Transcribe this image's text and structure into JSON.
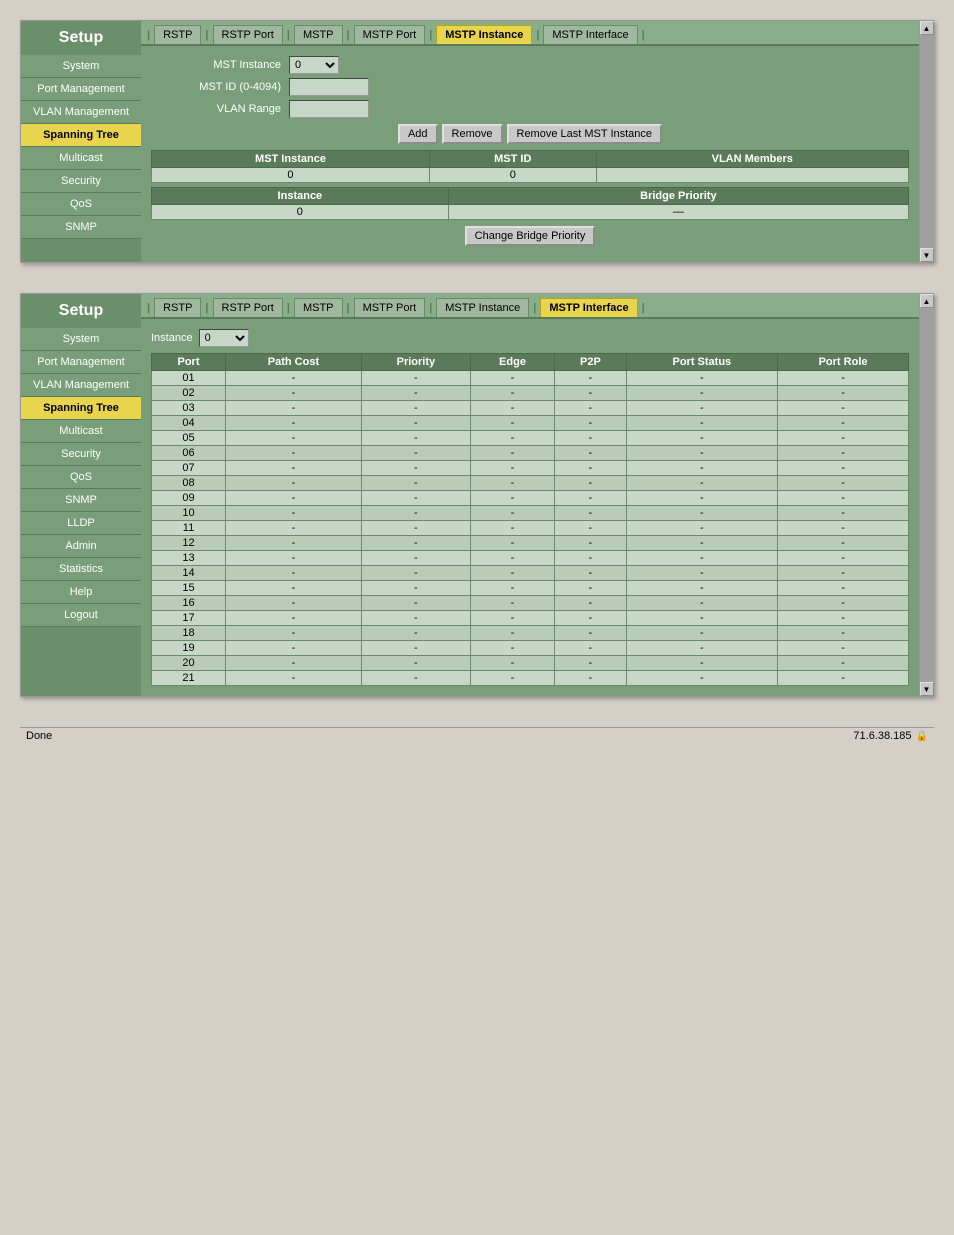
{
  "panel1": {
    "sidebar": {
      "title": "Setup",
      "items": [
        {
          "label": "System",
          "active": false
        },
        {
          "label": "Port Management",
          "active": false
        },
        {
          "label": "VLAN Management",
          "active": false
        },
        {
          "label": "Spanning Tree",
          "active": true
        },
        {
          "label": "Multicast",
          "active": false
        },
        {
          "label": "Security",
          "active": false
        },
        {
          "label": "QoS",
          "active": false
        },
        {
          "label": "SNMP",
          "active": false
        }
      ]
    },
    "tabs": [
      {
        "label": "RSTP",
        "active": false
      },
      {
        "label": "RSTP Port",
        "active": false
      },
      {
        "label": "MSTP",
        "active": false
      },
      {
        "label": "MSTP Port",
        "active": false
      },
      {
        "label": "MSTP Instance",
        "active": true
      },
      {
        "label": "MSTP Interface",
        "active": false
      }
    ],
    "form": {
      "mst_instance_label": "MST Instance",
      "mst_instance_value": "0",
      "mst_id_label": "MST ID (0-4094)",
      "mst_id_value": "",
      "vlan_range_label": "VLAN Range",
      "vlan_range_value": ""
    },
    "buttons": {
      "add": "Add",
      "remove": "Remove",
      "remove_last": "Remove Last MST Instance"
    },
    "table1": {
      "headers": [
        "MST Instance",
        "MST ID",
        "VLAN Members"
      ],
      "rows": [
        [
          "0",
          "0",
          ""
        ]
      ]
    },
    "table2": {
      "headers": [
        "Instance",
        "Bridge Priority"
      ],
      "rows": [
        [
          "0",
          "—"
        ]
      ]
    },
    "change_bridge_priority": "Change Bridge Priority"
  },
  "panel2": {
    "sidebar": {
      "title": "Setup",
      "items": [
        {
          "label": "System",
          "active": false
        },
        {
          "label": "Port Management",
          "active": false
        },
        {
          "label": "VLAN Management",
          "active": false
        },
        {
          "label": "Spanning Tree",
          "active": true
        },
        {
          "label": "Multicast",
          "active": false
        },
        {
          "label": "Security",
          "active": false
        },
        {
          "label": "QoS",
          "active": false
        },
        {
          "label": "SNMP",
          "active": false
        },
        {
          "label": "LLDP",
          "active": false
        },
        {
          "label": "Admin",
          "active": false
        },
        {
          "label": "Statistics",
          "active": false
        },
        {
          "label": "Help",
          "active": false
        },
        {
          "label": "Logout",
          "active": false
        }
      ]
    },
    "tabs": [
      {
        "label": "RSTP",
        "active": false
      },
      {
        "label": "RSTP Port",
        "active": false
      },
      {
        "label": "MSTP",
        "active": false
      },
      {
        "label": "MSTP Port",
        "active": false
      },
      {
        "label": "MSTP Instance",
        "active": false
      },
      {
        "label": "MSTP Interface",
        "active": true
      }
    ],
    "instance_label": "Instance",
    "instance_value": "0",
    "table": {
      "headers": [
        "Port",
        "Path Cost",
        "Priority",
        "Edge",
        "P2P",
        "Port Status",
        "Port Role"
      ],
      "rows": [
        {
          "port": "01",
          "path_cost": "-",
          "priority": "-",
          "edge": "-",
          "p2p": "-",
          "port_status": "-",
          "port_role": "-",
          "alt": false
        },
        {
          "port": "02",
          "path_cost": "-",
          "priority": "-",
          "edge": "-",
          "p2p": "-",
          "port_status": "-",
          "port_role": "-",
          "alt": true
        },
        {
          "port": "03",
          "path_cost": "-",
          "priority": "-",
          "edge": "-",
          "p2p": "-",
          "port_status": "-",
          "port_role": "-",
          "alt": false
        },
        {
          "port": "04",
          "path_cost": "-",
          "priority": "-",
          "edge": "-",
          "p2p": "-",
          "port_status": "-",
          "port_role": "-",
          "alt": true
        },
        {
          "port": "05",
          "path_cost": "-",
          "priority": "-",
          "edge": "-",
          "p2p": "-",
          "port_status": "-",
          "port_role": "-",
          "alt": false
        },
        {
          "port": "06",
          "path_cost": "-",
          "priority": "-",
          "edge": "-",
          "p2p": "-",
          "port_status": "-",
          "port_role": "-",
          "alt": true
        },
        {
          "port": "07",
          "path_cost": "-",
          "priority": "-",
          "edge": "-",
          "p2p": "-",
          "port_status": "-",
          "port_role": "-",
          "alt": false
        },
        {
          "port": "08",
          "path_cost": "-",
          "priority": "-",
          "edge": "-",
          "p2p": "-",
          "port_status": "-",
          "port_role": "-",
          "alt": true
        },
        {
          "port": "09",
          "path_cost": "-",
          "priority": "-",
          "edge": "-",
          "p2p": "-",
          "port_status": "-",
          "port_role": "-",
          "alt": false
        },
        {
          "port": "10",
          "path_cost": "-",
          "priority": "-",
          "edge": "-",
          "p2p": "-",
          "port_status": "-",
          "port_role": "-",
          "alt": true
        },
        {
          "port": "11",
          "path_cost": "-",
          "priority": "-",
          "edge": "-",
          "p2p": "-",
          "port_status": "-",
          "port_role": "-",
          "alt": false
        },
        {
          "port": "12",
          "path_cost": "-",
          "priority": "-",
          "edge": "-",
          "p2p": "-",
          "port_status": "-",
          "port_role": "-",
          "alt": true
        },
        {
          "port": "13",
          "path_cost": "-",
          "priority": "-",
          "edge": "-",
          "p2p": "-",
          "port_status": "-",
          "port_role": "-",
          "alt": false
        },
        {
          "port": "14",
          "path_cost": "-",
          "priority": "-",
          "edge": "-",
          "p2p": "-",
          "port_status": "-",
          "port_role": "-",
          "alt": true
        },
        {
          "port": "15",
          "path_cost": "-",
          "priority": "-",
          "edge": "-",
          "p2p": "-",
          "port_status": "-",
          "port_role": "-",
          "alt": false
        },
        {
          "port": "16",
          "path_cost": "-",
          "priority": "-",
          "edge": "-",
          "p2p": "-",
          "port_status": "-",
          "port_role": "-",
          "alt": true
        },
        {
          "port": "17",
          "path_cost": "-",
          "priority": "-",
          "edge": "-",
          "p2p": "-",
          "port_status": "-",
          "port_role": "-",
          "alt": false
        },
        {
          "port": "18",
          "path_cost": "-",
          "priority": "-",
          "edge": "-",
          "p2p": "-",
          "port_status": "-",
          "port_role": "-",
          "alt": true
        },
        {
          "port": "19",
          "path_cost": "-",
          "priority": "-",
          "edge": "-",
          "p2p": "-",
          "port_status": "-",
          "port_role": "-",
          "alt": false
        },
        {
          "port": "20",
          "path_cost": "-",
          "priority": "-",
          "edge": "-",
          "p2p": "-",
          "port_status": "-",
          "port_role": "-",
          "alt": true
        },
        {
          "port": "21",
          "path_cost": "-",
          "priority": "-",
          "edge": "-",
          "p2p": "-",
          "port_status": "-",
          "port_role": "-",
          "alt": false
        }
      ]
    }
  },
  "status_bar": {
    "left": "Done",
    "right": "71.6.38.185"
  }
}
